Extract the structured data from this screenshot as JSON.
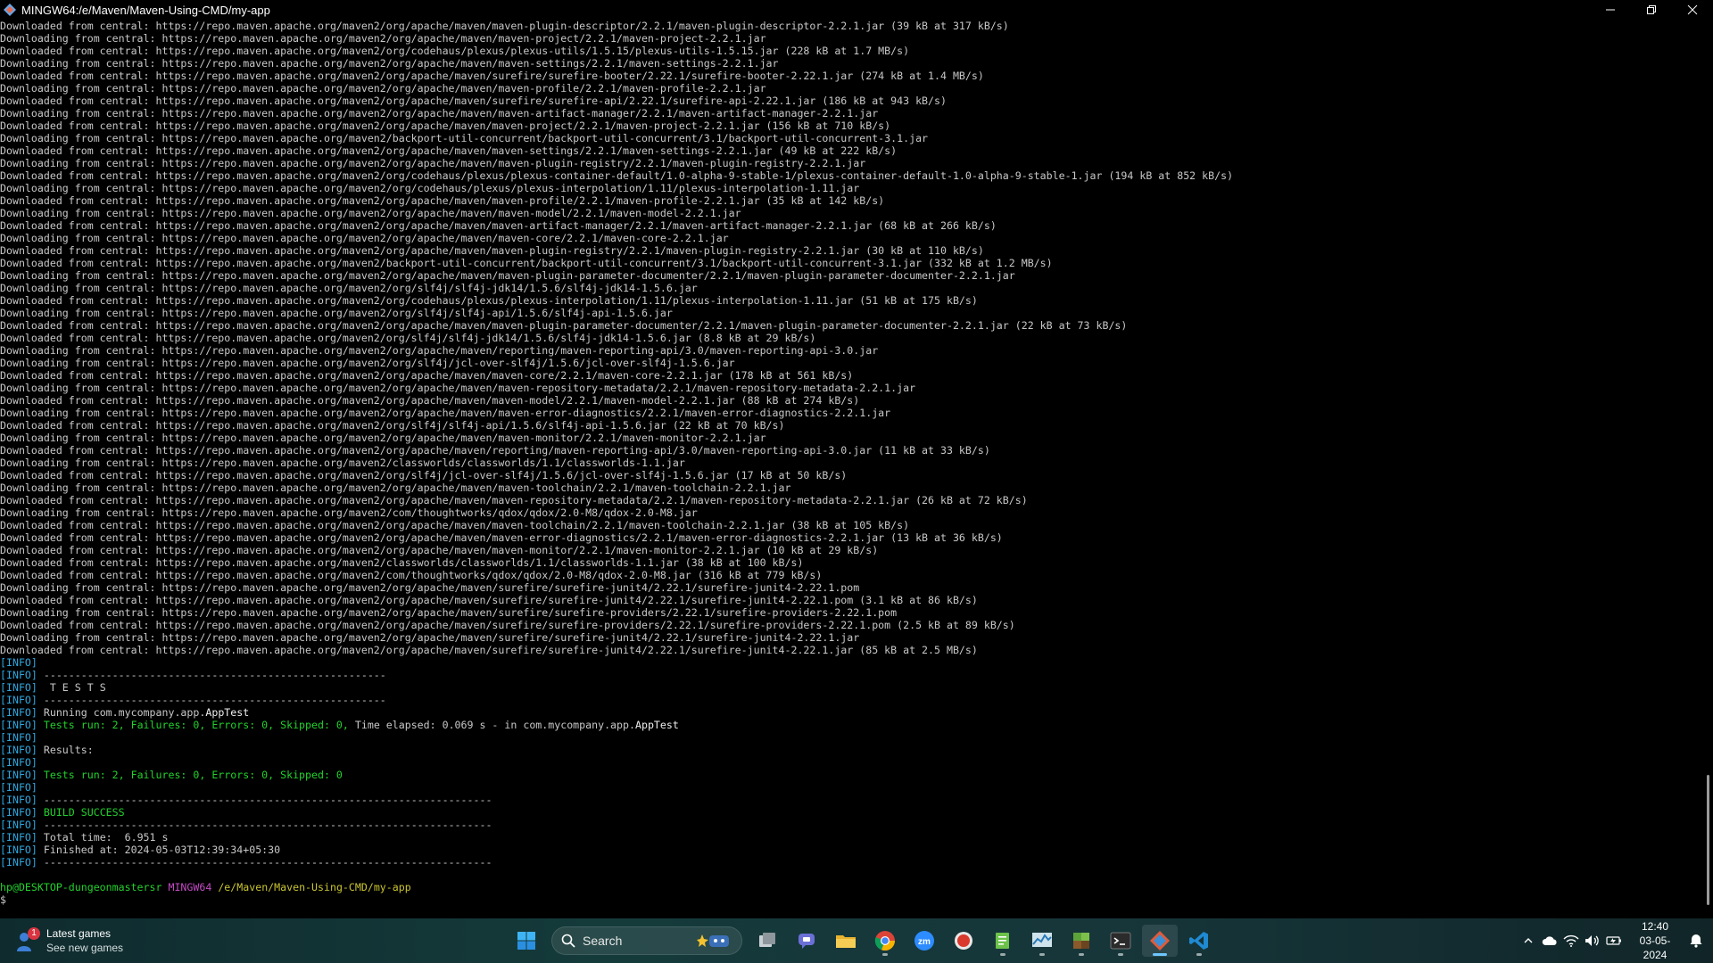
{
  "window": {
    "title": "MINGW64:/e/Maven/Maven-Using-CMD/my-app",
    "icon": "mingw-terminal-icon"
  },
  "terminal": {
    "lines": [
      {
        "text": "Downloaded from central: https://repo.maven.apache.org/maven2/org/apache/maven/maven-plugin-descriptor/2.2.1/maven-plugin-descriptor-2.2.1.jar (39 kB at 317 kB/s)"
      },
      {
        "text": "Downloading from central: https://repo.maven.apache.org/maven2/org/apache/maven/maven-project/2.2.1/maven-project-2.2.1.jar"
      },
      {
        "text": "Downloaded from central: https://repo.maven.apache.org/maven2/org/codehaus/plexus/plexus-utils/1.5.15/plexus-utils-1.5.15.jar (228 kB at 1.7 MB/s)"
      },
      {
        "text": "Downloading from central: https://repo.maven.apache.org/maven2/org/apache/maven/maven-settings/2.2.1/maven-settings-2.2.1.jar"
      },
      {
        "text": "Downloaded from central: https://repo.maven.apache.org/maven2/org/apache/maven/surefire/surefire-booter/2.22.1/surefire-booter-2.22.1.jar (274 kB at 1.4 MB/s)"
      },
      {
        "text": "Downloading from central: https://repo.maven.apache.org/maven2/org/apache/maven/maven-profile/2.2.1/maven-profile-2.2.1.jar"
      },
      {
        "text": "Downloaded from central: https://repo.maven.apache.org/maven2/org/apache/maven/surefire/surefire-api/2.22.1/surefire-api-2.22.1.jar (186 kB at 943 kB/s)"
      },
      {
        "text": "Downloading from central: https://repo.maven.apache.org/maven2/org/apache/maven/maven-artifact-manager/2.2.1/maven-artifact-manager-2.2.1.jar"
      },
      {
        "text": "Downloaded from central: https://repo.maven.apache.org/maven2/org/apache/maven/maven-project/2.2.1/maven-project-2.2.1.jar (156 kB at 710 kB/s)"
      },
      {
        "text": "Downloading from central: https://repo.maven.apache.org/maven2/backport-util-concurrent/backport-util-concurrent/3.1/backport-util-concurrent-3.1.jar"
      },
      {
        "text": "Downloaded from central: https://repo.maven.apache.org/maven2/org/apache/maven/maven-settings/2.2.1/maven-settings-2.2.1.jar (49 kB at 222 kB/s)"
      },
      {
        "text": "Downloading from central: https://repo.maven.apache.org/maven2/org/apache/maven/maven-plugin-registry/2.2.1/maven-plugin-registry-2.2.1.jar"
      },
      {
        "text": "Downloaded from central: https://repo.maven.apache.org/maven2/org/codehaus/plexus/plexus-container-default/1.0-alpha-9-stable-1/plexus-container-default-1.0-alpha-9-stable-1.jar (194 kB at 852 kB/s)"
      },
      {
        "text": "Downloading from central: https://repo.maven.apache.org/maven2/org/codehaus/plexus/plexus-interpolation/1.11/plexus-interpolation-1.11.jar"
      },
      {
        "text": "Downloaded from central: https://repo.maven.apache.org/maven2/org/apache/maven/maven-profile/2.2.1/maven-profile-2.2.1.jar (35 kB at 142 kB/s)"
      },
      {
        "text": "Downloading from central: https://repo.maven.apache.org/maven2/org/apache/maven/maven-model/2.2.1/maven-model-2.2.1.jar"
      },
      {
        "text": "Downloaded from central: https://repo.maven.apache.org/maven2/org/apache/maven/maven-artifact-manager/2.2.1/maven-artifact-manager-2.2.1.jar (68 kB at 266 kB/s)"
      },
      {
        "text": "Downloading from central: https://repo.maven.apache.org/maven2/org/apache/maven/maven-core/2.2.1/maven-core-2.2.1.jar"
      },
      {
        "text": "Downloaded from central: https://repo.maven.apache.org/maven2/org/apache/maven/maven-plugin-registry/2.2.1/maven-plugin-registry-2.2.1.jar (30 kB at 110 kB/s)"
      },
      {
        "text": "Downloaded from central: https://repo.maven.apache.org/maven2/backport-util-concurrent/backport-util-concurrent/3.1/backport-util-concurrent-3.1.jar (332 kB at 1.2 MB/s)"
      },
      {
        "text": "Downloading from central: https://repo.maven.apache.org/maven2/org/apache/maven/maven-plugin-parameter-documenter/2.2.1/maven-plugin-parameter-documenter-2.2.1.jar"
      },
      {
        "text": "Downloading from central: https://repo.maven.apache.org/maven2/org/slf4j/slf4j-jdk14/1.5.6/slf4j-jdk14-1.5.6.jar"
      },
      {
        "text": "Downloaded from central: https://repo.maven.apache.org/maven2/org/codehaus/plexus/plexus-interpolation/1.11/plexus-interpolation-1.11.jar (51 kB at 175 kB/s)"
      },
      {
        "text": "Downloading from central: https://repo.maven.apache.org/maven2/org/slf4j/slf4j-api/1.5.6/slf4j-api-1.5.6.jar"
      },
      {
        "text": "Downloaded from central: https://repo.maven.apache.org/maven2/org/apache/maven/maven-plugin-parameter-documenter/2.2.1/maven-plugin-parameter-documenter-2.2.1.jar (22 kB at 73 kB/s)"
      },
      {
        "text": "Downloaded from central: https://repo.maven.apache.org/maven2/org/slf4j/slf4j-jdk14/1.5.6/slf4j-jdk14-1.5.6.jar (8.8 kB at 29 kB/s)"
      },
      {
        "text": "Downloading from central: https://repo.maven.apache.org/maven2/org/apache/maven/reporting/maven-reporting-api/3.0/maven-reporting-api-3.0.jar"
      },
      {
        "text": "Downloading from central: https://repo.maven.apache.org/maven2/org/slf4j/jcl-over-slf4j/1.5.6/jcl-over-slf4j-1.5.6.jar"
      },
      {
        "text": "Downloaded from central: https://repo.maven.apache.org/maven2/org/apache/maven/maven-core/2.2.1/maven-core-2.2.1.jar (178 kB at 561 kB/s)"
      },
      {
        "text": "Downloading from central: https://repo.maven.apache.org/maven2/org/apache/maven/maven-repository-metadata/2.2.1/maven-repository-metadata-2.2.1.jar"
      },
      {
        "text": "Downloaded from central: https://repo.maven.apache.org/maven2/org/apache/maven/maven-model/2.2.1/maven-model-2.2.1.jar (88 kB at 274 kB/s)"
      },
      {
        "text": "Downloading from central: https://repo.maven.apache.org/maven2/org/apache/maven/maven-error-diagnostics/2.2.1/maven-error-diagnostics-2.2.1.jar"
      },
      {
        "text": "Downloaded from central: https://repo.maven.apache.org/maven2/org/slf4j/slf4j-api/1.5.6/slf4j-api-1.5.6.jar (22 kB at 70 kB/s)"
      },
      {
        "text": "Downloading from central: https://repo.maven.apache.org/maven2/org/apache/maven/maven-monitor/2.2.1/maven-monitor-2.2.1.jar"
      },
      {
        "text": "Downloaded from central: https://repo.maven.apache.org/maven2/org/apache/maven/reporting/maven-reporting-api/3.0/maven-reporting-api-3.0.jar (11 kB at 33 kB/s)"
      },
      {
        "text": "Downloading from central: https://repo.maven.apache.org/maven2/classworlds/classworlds/1.1/classworlds-1.1.jar"
      },
      {
        "text": "Downloaded from central: https://repo.maven.apache.org/maven2/org/slf4j/jcl-over-slf4j/1.5.6/jcl-over-slf4j-1.5.6.jar (17 kB at 50 kB/s)"
      },
      {
        "text": "Downloading from central: https://repo.maven.apache.org/maven2/org/apache/maven/maven-toolchain/2.2.1/maven-toolchain-2.2.1.jar"
      },
      {
        "text": "Downloaded from central: https://repo.maven.apache.org/maven2/org/apache/maven/maven-repository-metadata/2.2.1/maven-repository-metadata-2.2.1.jar (26 kB at 72 kB/s)"
      },
      {
        "text": "Downloading from central: https://repo.maven.apache.org/maven2/com/thoughtworks/qdox/qdox/2.0-M8/qdox-2.0-M8.jar"
      },
      {
        "text": "Downloaded from central: https://repo.maven.apache.org/maven2/org/apache/maven/maven-toolchain/2.2.1/maven-toolchain-2.2.1.jar (38 kB at 105 kB/s)"
      },
      {
        "text": "Downloaded from central: https://repo.maven.apache.org/maven2/org/apache/maven/maven-error-diagnostics/2.2.1/maven-error-diagnostics-2.2.1.jar (13 kB at 36 kB/s)"
      },
      {
        "text": "Downloaded from central: https://repo.maven.apache.org/maven2/org/apache/maven/maven-monitor/2.2.1/maven-monitor-2.2.1.jar (10 kB at 29 kB/s)"
      },
      {
        "text": "Downloaded from central: https://repo.maven.apache.org/maven2/classworlds/classworlds/1.1/classworlds-1.1.jar (38 kB at 100 kB/s)"
      },
      {
        "text": "Downloaded from central: https://repo.maven.apache.org/maven2/com/thoughtworks/qdox/qdox/2.0-M8/qdox-2.0-M8.jar (316 kB at 779 kB/s)"
      },
      {
        "text": "Downloading from central: https://repo.maven.apache.org/maven2/org/apache/maven/surefire/surefire-junit4/2.22.1/surefire-junit4-2.22.1.pom"
      },
      {
        "text": "Downloaded from central: https://repo.maven.apache.org/maven2/org/apache/maven/surefire/surefire-junit4/2.22.1/surefire-junit4-2.22.1.pom (3.1 kB at 86 kB/s)"
      },
      {
        "text": "Downloading from central: https://repo.maven.apache.org/maven2/org/apache/maven/surefire/surefire-providers/2.22.1/surefire-providers-2.22.1.pom"
      },
      {
        "text": "Downloaded from central: https://repo.maven.apache.org/maven2/org/apache/maven/surefire/surefire-providers/2.22.1/surefire-providers-2.22.1.pom (2.5 kB at 89 kB/s)"
      },
      {
        "text": "Downloading from central: https://repo.maven.apache.org/maven2/org/apache/maven/surefire/surefire-junit4/2.22.1/surefire-junit4-2.22.1.jar"
      },
      {
        "text": "Downloaded from central: https://repo.maven.apache.org/maven2/org/apache/maven/surefire/surefire-junit4/2.22.1/surefire-junit4-2.22.1.jar (85 kB at 2.5 MB/s)"
      },
      {
        "tag": "[INFO]",
        "text": ""
      },
      {
        "tag": "[INFO]",
        "text": " -------------------------------------------------------"
      },
      {
        "tag": "[INFO]",
        "text": "  T E S T S"
      },
      {
        "tag": "[INFO]",
        "text": " -------------------------------------------------------"
      },
      {
        "tag": "[INFO]",
        "text": " Running com.mycompany.app.",
        "em": "AppTest"
      },
      {
        "tag": "[INFO]",
        "status": " Tests run: 2, Failures: 0, Errors: 0, Skipped: 0, ",
        "text": "Time elapsed: 0.069 s - in com.mycompany.app.",
        "em": "AppTest"
      },
      {
        "tag": "[INFO]",
        "text": ""
      },
      {
        "tag": "[INFO]",
        "text": " Results:"
      },
      {
        "tag": "[INFO]",
        "text": ""
      },
      {
        "tag": "[INFO]",
        "status": " Tests run: 2, Failures: 0, Errors: 0, Skipped: 0"
      },
      {
        "tag": "[INFO]",
        "text": ""
      },
      {
        "tag": "[INFO]",
        "text": " ------------------------------------------------------------------------"
      },
      {
        "tag": "[INFO]",
        "status": " BUILD SUCCESS"
      },
      {
        "tag": "[INFO]",
        "text": " ------------------------------------------------------------------------"
      },
      {
        "tag": "[INFO]",
        "text": " Total time:  6.951 s"
      },
      {
        "tag": "[INFO]",
        "text": " Finished at: 2024-05-03T12:39:34+05:30"
      },
      {
        "tag": "[INFO]",
        "text": " ------------------------------------------------------------------------"
      },
      {
        "text": ""
      },
      {
        "prompt": {
          "user": "hp@DESKTOP-dungeonmastersr",
          "shell": "MINGW64",
          "path": "/e/Maven/Maven-Using-CMD/my-app"
        }
      },
      {
        "text": "$"
      }
    ],
    "colors": {
      "info": "#2ea8e0",
      "success": "#22d22d",
      "text": "#c8c8c8"
    }
  },
  "scrollbar": {
    "thumb_start": 0.84,
    "thumb_end": 0.985
  },
  "taskbar": {
    "widget": {
      "title": "Latest games",
      "subtitle": "See new games",
      "badge": "1",
      "icon": "games-widget-icon"
    },
    "search": {
      "placeholder": "Search"
    },
    "apps": [
      {
        "name": "start-button",
        "icon": "windows-start-icon",
        "active": false,
        "running": false
      },
      {
        "name": "search-box",
        "icon": "search-icon"
      },
      {
        "name": "task-view-button",
        "icon": "task-view-icon",
        "active": false,
        "running": false
      },
      {
        "name": "teams-chat-button",
        "icon": "chat-icon",
        "active": false,
        "running": false
      },
      {
        "name": "file-explorer-button",
        "icon": "folder-icon",
        "active": false,
        "running": false
      },
      {
        "name": "chrome-button",
        "icon": "chrome-icon",
        "active": false,
        "running": true
      },
      {
        "name": "zoom-button",
        "icon": "zoom-icon",
        "active": false,
        "running": false
      },
      {
        "name": "recorder-button",
        "icon": "record-icon",
        "active": false,
        "running": false
      },
      {
        "name": "notepad-button",
        "icon": "notepad-icon",
        "active": false,
        "running": true
      },
      {
        "name": "task-manager-button",
        "icon": "task-manager-icon",
        "active": false,
        "running": true
      },
      {
        "name": "minecraft-button",
        "icon": "minecraft-icon",
        "active": false,
        "running": true
      },
      {
        "name": "terminal-button",
        "icon": "terminal-icon",
        "active": false,
        "running": true
      },
      {
        "name": "git-bash-button",
        "icon": "git-icon",
        "active": true,
        "running": true
      },
      {
        "name": "vscode-button",
        "icon": "vscode-icon",
        "active": false,
        "running": true
      }
    ],
    "tray": {
      "time": "12:40",
      "date": "03-05-2024"
    }
  }
}
